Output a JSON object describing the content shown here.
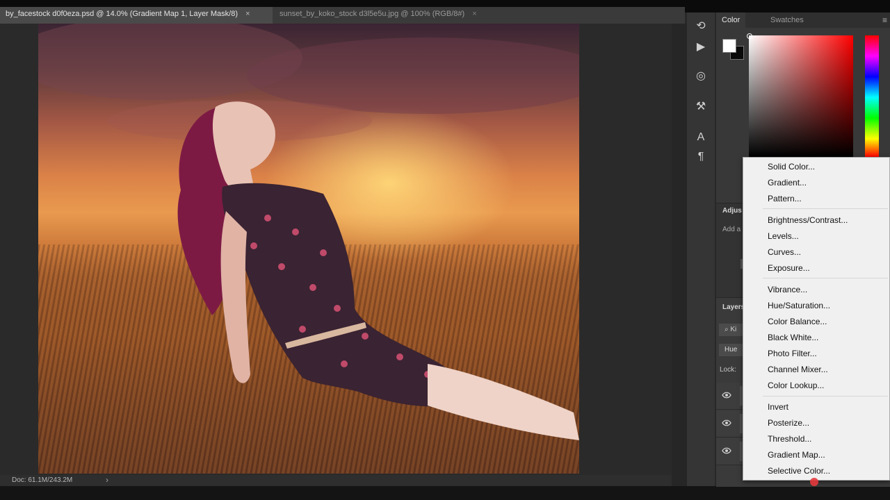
{
  "document_tabs": [
    {
      "label": "by_facestock d0f0eza.psd @ 14.0% (Gradient Map 1, Layer Mask/8)",
      "active": true,
      "close": "×"
    },
    {
      "label": "sunset_by_koko_stock d3l5e5u.jpg @ 100% (RGB/8#)",
      "active": false,
      "close": "×"
    }
  ],
  "status": {
    "doc_size": "Doc: 61.1M/243.2M",
    "arrow": "›"
  },
  "tools": [
    {
      "icon": "history-icon",
      "glyph": "⟲"
    },
    {
      "icon": "play-icon",
      "glyph": "▶"
    },
    {
      "icon": "adjustments-icon",
      "glyph": "◎"
    },
    {
      "icon": "brush-presets-icon",
      "glyph": "⚒"
    },
    {
      "icon": "character-icon",
      "glyph": "A"
    },
    {
      "icon": "paragraph-icon",
      "glyph": "¶"
    }
  ],
  "color_panel": {
    "tabs": [
      "Color",
      "Swatches"
    ],
    "menu_glyph": "≡",
    "foreground": "#ffffff",
    "background": "#0a0a0a",
    "hue": "#ff0000"
  },
  "adjustments": {
    "title": "Adjus",
    "subtitle": "Add a"
  },
  "layers": {
    "title": "Layers",
    "filter_label": "Ki",
    "blend_mode": "Hue",
    "lock_label": "Lock:"
  },
  "adjustment_menu": {
    "groups": [
      [
        "Solid Color...",
        "Gradient...",
        "Pattern..."
      ],
      [
        "Brightness/Contrast...",
        "Levels...",
        "Curves...",
        "Exposure..."
      ],
      [
        "Vibrance...",
        "Hue/Saturation...",
        "Color Balance...",
        "Black  White...",
        "Photo Filter...",
        "Channel Mixer...",
        "Color Lookup..."
      ],
      [
        "Invert",
        "Posterize...",
        "Threshold...",
        "Gradient Map...",
        "Selective Color..."
      ]
    ]
  }
}
